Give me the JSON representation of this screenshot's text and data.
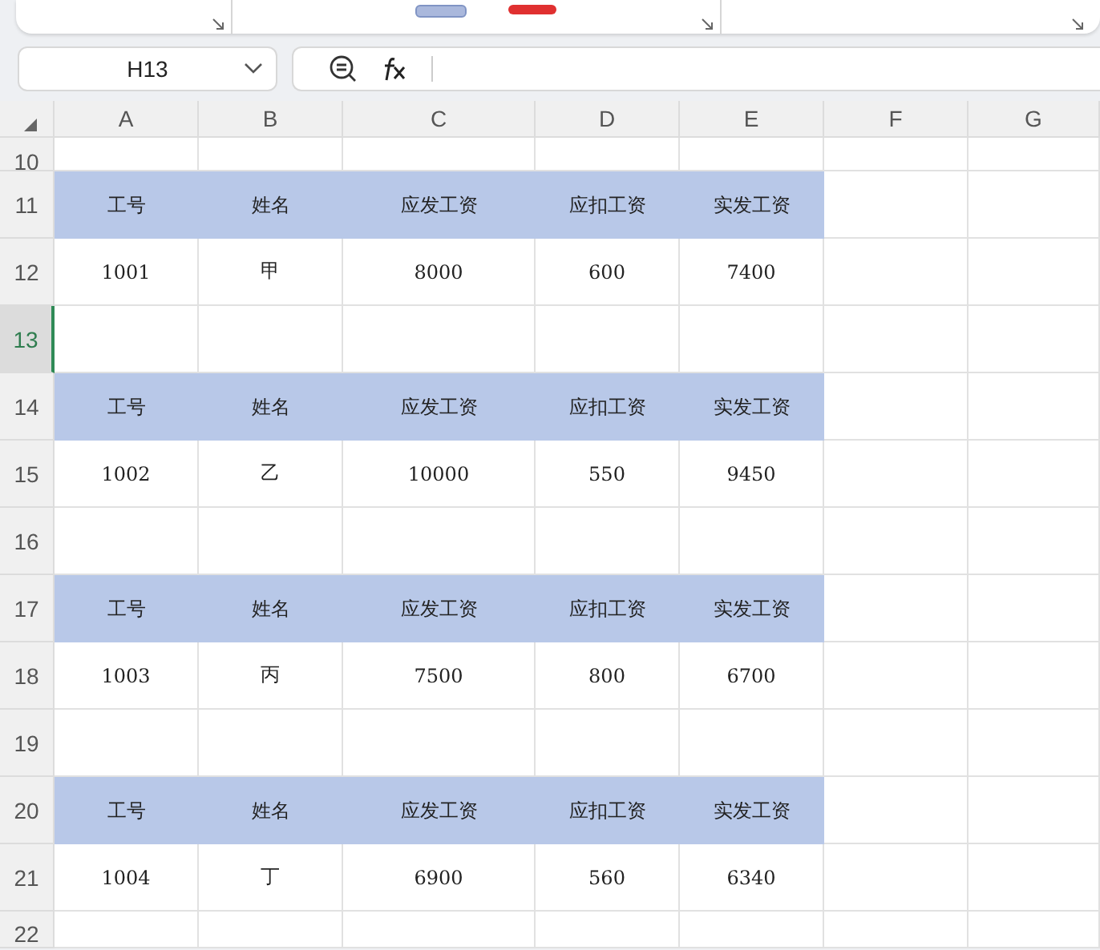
{
  "name_box": {
    "value": "H13"
  },
  "columns": [
    {
      "label": "A",
      "selected": false
    },
    {
      "label": "B",
      "selected": false
    },
    {
      "label": "C",
      "selected": false
    },
    {
      "label": "D",
      "selected": false
    },
    {
      "label": "E",
      "selected": false
    },
    {
      "label": "F",
      "selected": false
    },
    {
      "label": "G",
      "selected": false
    }
  ],
  "rows": [
    {
      "number": "10",
      "selected": false,
      "kind": "empty",
      "cells": []
    },
    {
      "number": "11",
      "selected": false,
      "kind": "header",
      "cells": [
        "工号",
        "姓名",
        "应发工资",
        "应扣工资",
        "实发工资"
      ]
    },
    {
      "number": "12",
      "selected": false,
      "kind": "data",
      "cells": [
        "1001",
        "甲",
        "8000",
        "600",
        "7400"
      ]
    },
    {
      "number": "13",
      "selected": true,
      "kind": "empty",
      "cells": []
    },
    {
      "number": "14",
      "selected": false,
      "kind": "header",
      "cells": [
        "工号",
        "姓名",
        "应发工资",
        "应扣工资",
        "实发工资"
      ]
    },
    {
      "number": "15",
      "selected": false,
      "kind": "data",
      "cells": [
        "1002",
        "乙",
        "10000",
        "550",
        "9450"
      ]
    },
    {
      "number": "16",
      "selected": false,
      "kind": "empty",
      "cells": []
    },
    {
      "number": "17",
      "selected": false,
      "kind": "header",
      "cells": [
        "工号",
        "姓名",
        "应发工资",
        "应扣工资",
        "实发工资"
      ]
    },
    {
      "number": "18",
      "selected": false,
      "kind": "data",
      "cells": [
        "1003",
        "丙",
        "7500",
        "800",
        "6700"
      ]
    },
    {
      "number": "19",
      "selected": false,
      "kind": "empty",
      "cells": []
    },
    {
      "number": "20",
      "selected": false,
      "kind": "header",
      "cells": [
        "工号",
        "姓名",
        "应发工资",
        "应扣工资",
        "实发工资"
      ]
    },
    {
      "number": "21",
      "selected": false,
      "kind": "data",
      "cells": [
        "1004",
        "丁",
        "6900",
        "560",
        "6340"
      ]
    },
    {
      "number": "22",
      "selected": false,
      "kind": "empty",
      "cells": []
    }
  ]
}
